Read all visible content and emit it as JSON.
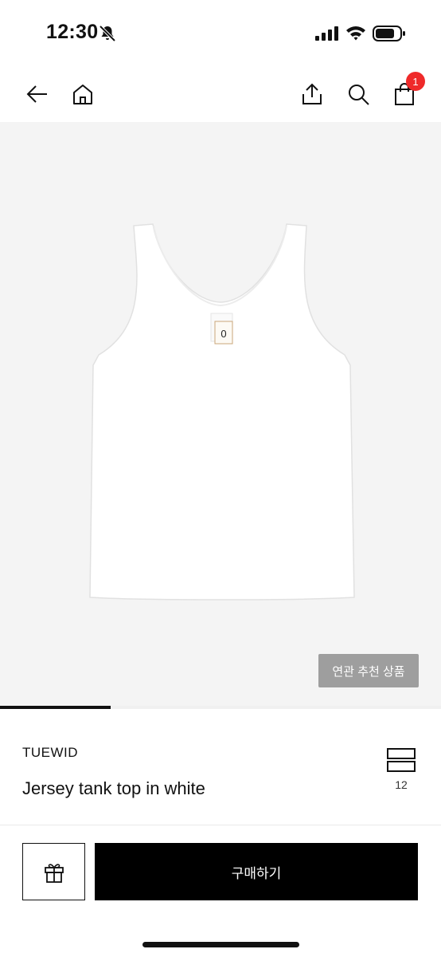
{
  "status_bar": {
    "time": "12:30"
  },
  "nav": {
    "cart_count": "1"
  },
  "hero": {
    "tag_text": "0",
    "related_button": "연관 추천 상품",
    "image_progress": 0.25
  },
  "product": {
    "brand": "TUEWID",
    "name": "Jersey tank top in white",
    "like_count": "12"
  },
  "actions": {
    "buy_label": "구매하기"
  },
  "icons": [
    "bell-off-icon",
    "signal-icon",
    "wifi-icon",
    "battery-icon",
    "back-arrow-icon",
    "home-icon",
    "share-icon",
    "search-icon",
    "shopping-bag-icon",
    "bookmark-icon",
    "gift-icon"
  ]
}
